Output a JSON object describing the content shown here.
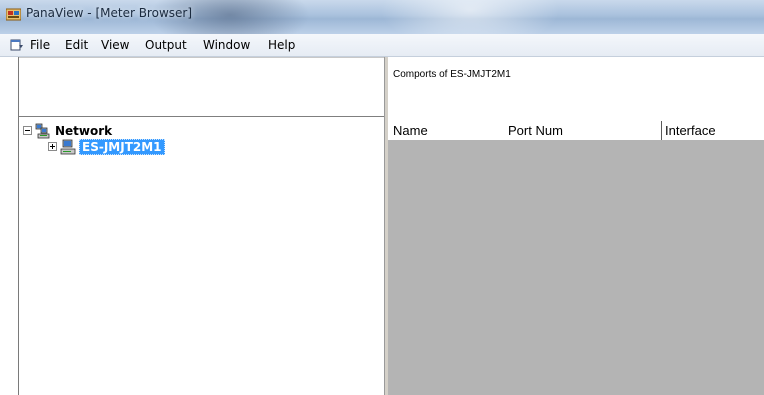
{
  "window": {
    "title": "PanaView - [Meter Browser]",
    "app_icon": "panaview-icon"
  },
  "menubar": {
    "doc_icon": "document-window-icon",
    "items": [
      "File",
      "Edit",
      "View",
      "Output",
      "Window",
      "Help"
    ]
  },
  "tree": {
    "root": {
      "label": "Network",
      "expander": "minus",
      "icon": "network-computers-icon"
    },
    "children": [
      {
        "label": "ES-JMJT2M1",
        "expander": "plus",
        "icon": "computer-icon",
        "selected": true
      }
    ]
  },
  "detail": {
    "caption": "Comports of ES-JMJT2M1",
    "columns": [
      "Name",
      "Port Num",
      "Interface"
    ],
    "rows": []
  },
  "colors": {
    "selection": "#3399ff",
    "list_background": "#b4b4b4"
  }
}
